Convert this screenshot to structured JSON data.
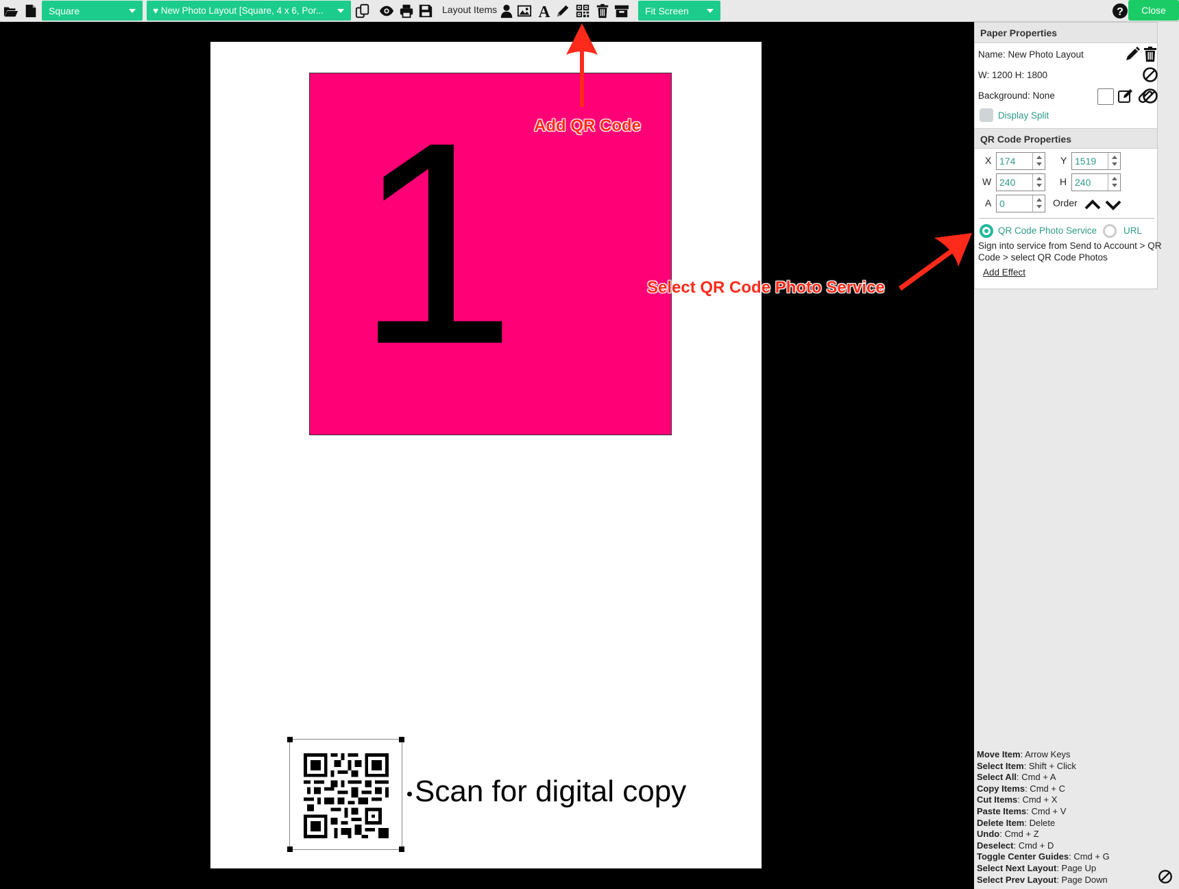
{
  "toolbar": {
    "paper_select": "Square",
    "layout_select": "♥ New Photo Layout [Square, 4 x 6, Por...",
    "layout_items_label": "Layout Items",
    "zoom_select": "Fit Screen",
    "close_label": "Close"
  },
  "canvas": {
    "photo_placeholder_number": "1",
    "qr_caption": "Scan for digital copy"
  },
  "annotations": {
    "add_qr": "Add QR Code",
    "select_service": "Select QR Code Photo Service"
  },
  "paper_properties": {
    "title": "Paper Properties",
    "name": "Name: New Photo Layout",
    "size": "W: 1200 H: 1800",
    "background": "Background: None",
    "display_split": "Display Split"
  },
  "qr_properties": {
    "title": "QR Code Properties",
    "x_label": "X",
    "x": "174",
    "y_label": "Y",
    "y": "1519",
    "w_label": "W",
    "w": "240",
    "h_label": "H",
    "h": "240",
    "a_label": "A",
    "a": "0",
    "order_label": "Order",
    "option_service": "QR Code Photo Service",
    "option_url": "URL",
    "hint_line1": "Sign into service from Send to Account > QR",
    "hint_line2": "Code > select QR Code Photos",
    "add_effect": "Add Effect"
  },
  "shortcuts": [
    {
      "key": "Move Item",
      "value": ": Arrow Keys"
    },
    {
      "key": "Select Item",
      "value": ": Shift + Click"
    },
    {
      "key": "Select All",
      "value": ": Cmd + A"
    },
    {
      "key": "Copy Items",
      "value": ": Cmd + C"
    },
    {
      "key": "Cut Items",
      "value": ": Cmd + X"
    },
    {
      "key": "Paste Items",
      "value": ": Cmd + V"
    },
    {
      "key": "Delete Item",
      "value": ": Delete"
    },
    {
      "key": "Undo",
      "value": ": Cmd + Z"
    },
    {
      "key": "Deselect",
      "value": ": Cmd + D"
    },
    {
      "key": "Toggle Center Guides",
      "value": ": Cmd + G"
    },
    {
      "key": "Select Next Layout",
      "value": ": Page Up"
    },
    {
      "key": "Select Prev Layout",
      "value": ": Page Down"
    }
  ],
  "colors": {
    "accent_green": "#1bcc8c",
    "photo_placeholder": "#ff0077",
    "annotation_red": "#ff2a1a",
    "radio_teal": "#1fb99a"
  }
}
